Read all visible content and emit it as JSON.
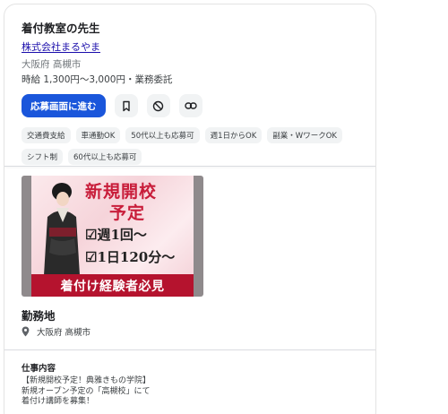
{
  "job": {
    "title": "着付教室の先生",
    "company": "株式会社まるやま",
    "location": "大阪府 高槻市",
    "salary": "時給 1,300円～3,000円・業務委託"
  },
  "actions": {
    "apply_label": "応募画面に進む",
    "icons": [
      "bookmark-icon",
      "block-icon",
      "link-icon"
    ]
  },
  "tags": [
    "交通費支給",
    "車通勤OK",
    "50代以上も応募可",
    "週1日からOK",
    "副業・WワークOK",
    "シフト制",
    "60代以上も応募可"
  ],
  "banner": {
    "line1": "新規開校",
    "line2": "予定",
    "line3": "☑週1回〜",
    "line4": "☑1日120分〜",
    "strip": "着付け経験者必見"
  },
  "workplace": {
    "heading": "勤務地",
    "location": "大阪府 高槻市"
  },
  "description": {
    "heading": "仕事内容",
    "lines": [
      "【新規開校予定！典雅きもの学院】",
      "新規オープン予定の「高槻校」にて",
      "着付け講師を募集！"
    ]
  },
  "colors": {
    "apply": "#1a56db",
    "link": "#1a0dab",
    "banner_red": "#c81d3a"
  }
}
